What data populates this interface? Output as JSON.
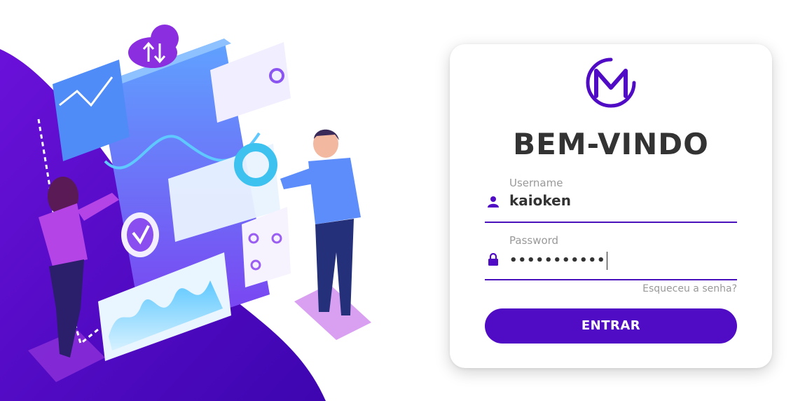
{
  "login": {
    "title": "BEM-VINDO",
    "username_label": "Username",
    "username_value": "kaioken",
    "password_label": "Password",
    "password_value": "•••••••••••",
    "forgot_link": "Esqueceu a senha?",
    "submit_label": "ENTRAR"
  },
  "colors": {
    "primary": "#4f0cc4",
    "underline": "#4a12bb",
    "title": "#333333",
    "label": "#999999"
  }
}
